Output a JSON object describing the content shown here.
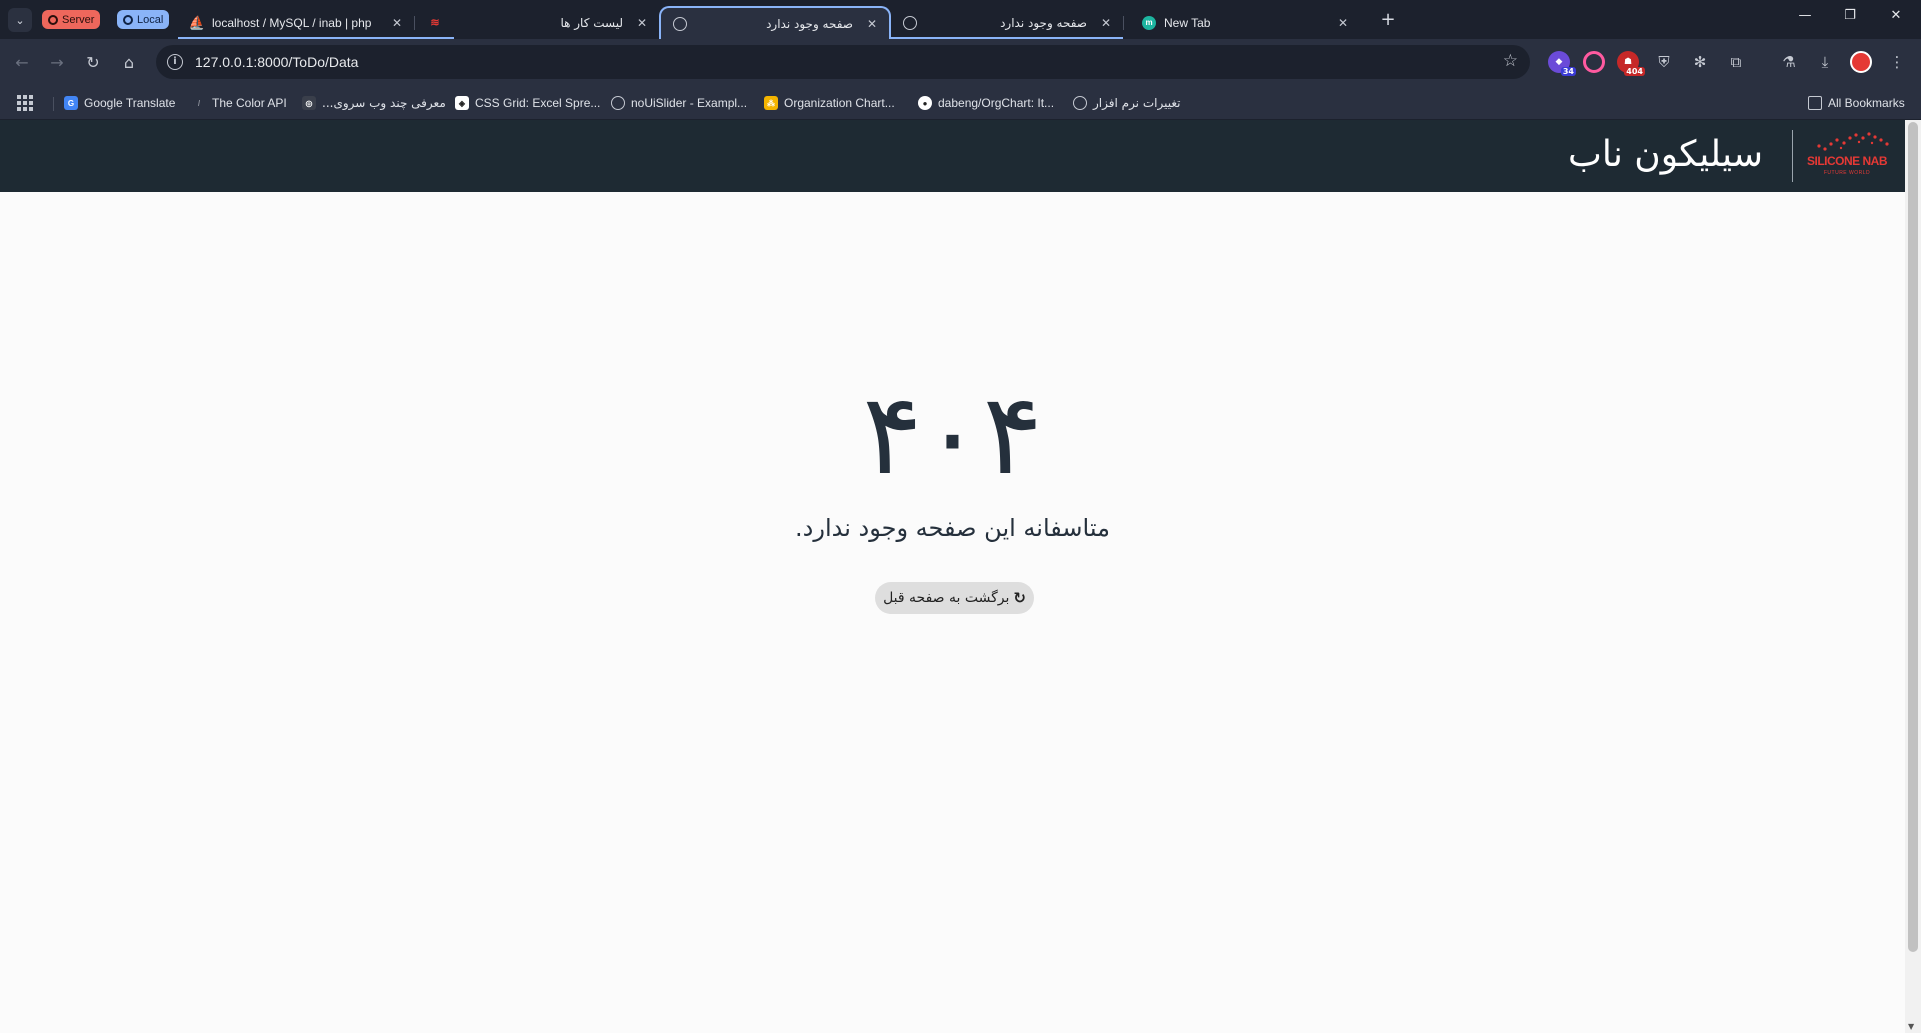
{
  "browser": {
    "groups": [
      {
        "label": "Server",
        "color": "#ee675c"
      },
      {
        "label": "Local",
        "color": "#8ab4f8"
      }
    ],
    "tabs": [
      {
        "title": "localhost / MySQL / inab | php",
        "favicon": "phpmyadmin-icon"
      },
      {
        "title": "",
        "favicon": "site-logo-icon"
      },
      {
        "title": "لیست کار ها",
        "favicon": "none"
      },
      {
        "title": "صفحه وجود ندارد",
        "favicon": "globe-icon",
        "active": true
      },
      {
        "title": "صفحه وجود ندارد",
        "favicon": "globe-icon"
      },
      {
        "title": "New Tab",
        "favicon": "m-icon"
      }
    ],
    "address": "127.0.0.1:8000/ToDo/Data",
    "extensions": [
      {
        "name": "extension-purple-icon",
        "badge": "34",
        "color": "#6b4bd8"
      },
      {
        "name": "extension-color-ring-icon",
        "color": "#ff5aa0"
      },
      {
        "name": "extension-404-icon",
        "badge": "404",
        "color": "#c62828"
      },
      {
        "name": "extension-shield-icon"
      },
      {
        "name": "extension-gear-icon"
      },
      {
        "name": "puzzle-icon"
      },
      {
        "name": "labs-flask-icon"
      },
      {
        "name": "download-icon"
      },
      {
        "name": "profile-icon"
      },
      {
        "name": "kebab-menu-icon"
      }
    ],
    "bookmarks": [
      {
        "label": "Google Translate",
        "icon": "google-translate-icon",
        "color": "#4285f4"
      },
      {
        "label": "The Color API",
        "icon": "slash-icon",
        "color": "#555"
      },
      {
        "label": "معرفی چند وب سروی...",
        "icon": "circle-logo-icon",
        "color": "#444"
      },
      {
        "label": "CSS Grid: Excel Spre...",
        "icon": "codepen-icon",
        "color": "#222"
      },
      {
        "label": "noUiSlider - Exampl...",
        "icon": "globe-icon",
        "color": "#555"
      },
      {
        "label": "Organization Chart...",
        "icon": "org-chart-icon",
        "color": "#f4b400"
      },
      {
        "label": "dabeng/OrgChart: It...",
        "icon": "github-icon",
        "color": "#222"
      },
      {
        "label": "تغییرات نرم افزار",
        "icon": "globe-icon",
        "color": "#555"
      }
    ],
    "all_bookmarks": "All Bookmarks"
  },
  "page": {
    "brand_name": "سیلیکون ناب",
    "brand_logo_text": "SILICONE NAB",
    "brand_logo_sub": "FUTURE WORLD",
    "brand_color": "#e53935",
    "header_bg": "#1e2a33",
    "error_code": "۴۰۴",
    "error_message": "متاسفانه این صفحه وجود ندارد.",
    "back_button": "برگشت به صفحه قبل",
    "text_color": "#25303c"
  }
}
